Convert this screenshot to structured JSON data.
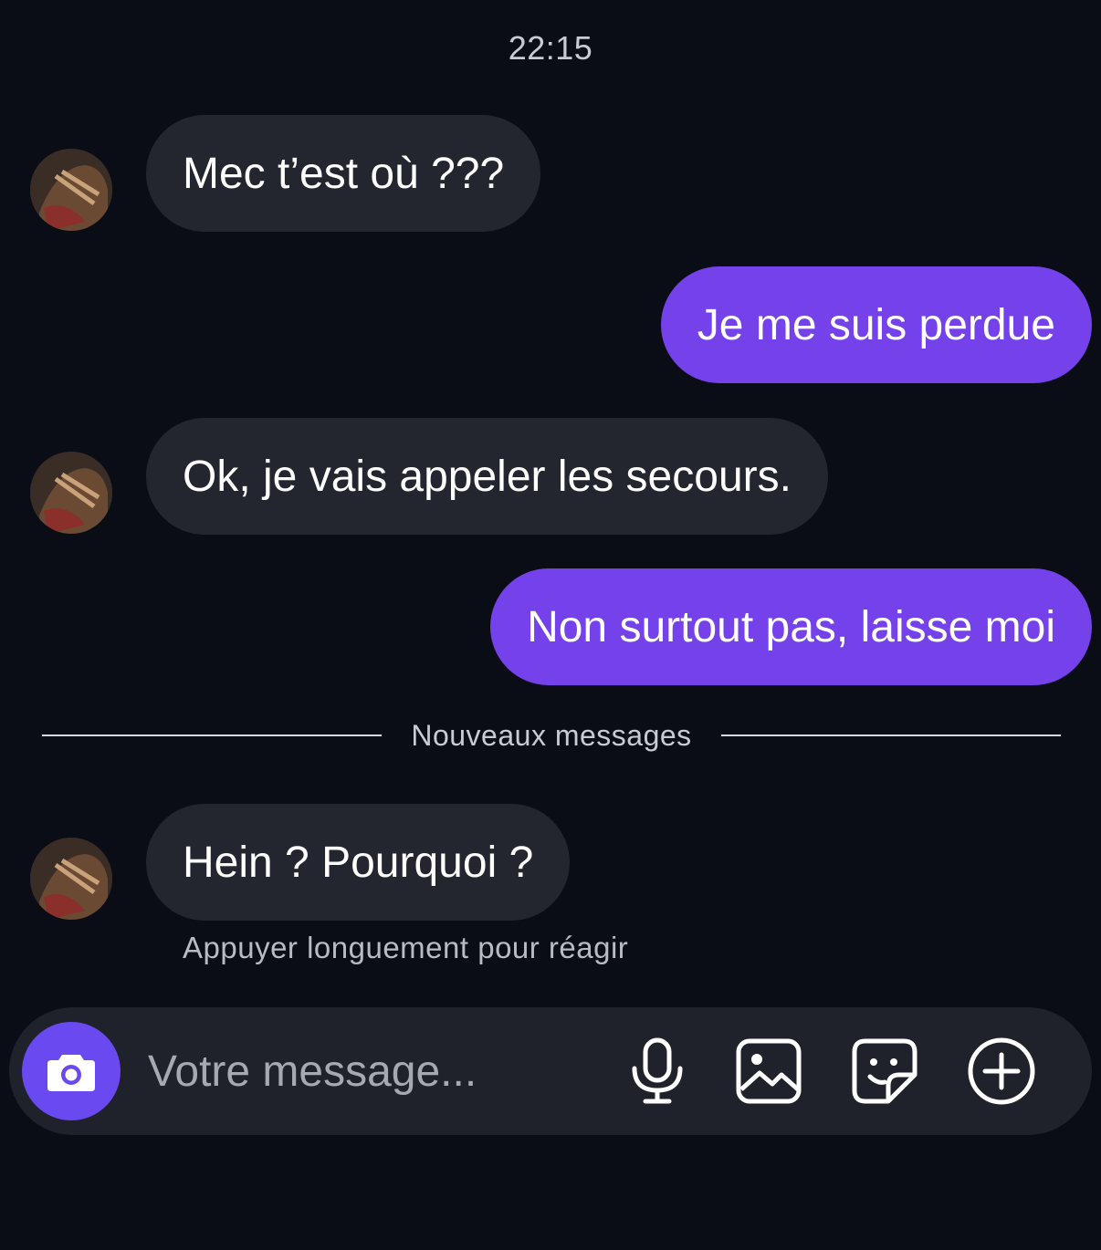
{
  "conversation": {
    "timestamp": "22:15",
    "messages": [
      {
        "from": "them",
        "text": "Mec t’est où ???"
      },
      {
        "from": "me",
        "text": "Je me suis perdue"
      },
      {
        "from": "them",
        "text": "Ok, je vais appeler les secours."
      },
      {
        "from": "me",
        "text": "Non surtout pas, laisse moi"
      },
      {
        "from": "them",
        "text": "Hein ? Pourquoi ?"
      }
    ],
    "divider_label": "Nouveaux messages",
    "reaction_hint": "Appuyer longuement pour réagir"
  },
  "composer": {
    "placeholder": "Votre message...",
    "icons": [
      "camera-icon",
      "microphone-icon",
      "image-icon",
      "sticker-icon",
      "plus-icon"
    ]
  },
  "colors": {
    "background": "#0b0d16",
    "incoming_bubble": "#23252f",
    "outgoing_bubble": "#7441ea",
    "camera_button": "#6a4af0",
    "composer": "#1f222b"
  }
}
